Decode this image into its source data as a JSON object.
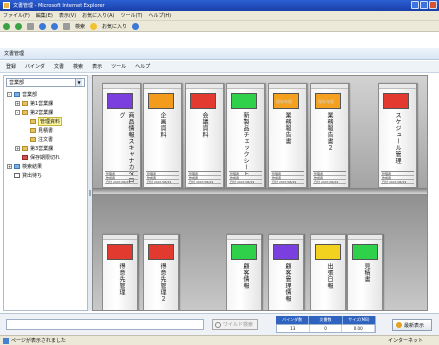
{
  "window": {
    "title": "文書管理 - Microsoft Internet Explorer"
  },
  "ie_menu": [
    "ファイル(F)",
    "編集(E)",
    "表示(V)",
    "お気に入り(A)",
    "ツール(T)",
    "ヘルプ(H)"
  ],
  "ie_toolbar": {
    "search_label": "検索",
    "favorites_label": "お気に入り"
  },
  "app": {
    "title": "文書管理",
    "menu": [
      "登録",
      "バインダ",
      "文書",
      "検索",
      "表示",
      "ツール",
      "ヘルプ"
    ]
  },
  "sidebar": {
    "dept_value": "営業部",
    "tree": [
      {
        "label": "営業部",
        "level": 0,
        "toggle": "-",
        "icon": "folder-blue"
      },
      {
        "label": "第1営業課",
        "level": 1,
        "toggle": "+",
        "icon": "folder"
      },
      {
        "label": "第2営業課",
        "level": 1,
        "toggle": "-",
        "icon": "folder"
      },
      {
        "label": "管理資料",
        "level": 2,
        "toggle": "",
        "icon": "folder",
        "selected": true
      },
      {
        "label": "見積書",
        "level": 2,
        "toggle": "",
        "icon": "folder"
      },
      {
        "label": "注文書",
        "level": 2,
        "toggle": "",
        "icon": "folder"
      },
      {
        "label": "第3営業課",
        "level": 1,
        "toggle": "+",
        "icon": "folder"
      },
      {
        "label": "保存期限切れ",
        "level": 1,
        "toggle": "",
        "icon": "folder-red"
      },
      {
        "label": "検索結果",
        "level": 0,
        "toggle": "+",
        "icon": "folder-blue"
      },
      {
        "label": "貸出待ち",
        "level": 0,
        "toggle": "",
        "icon": "doc"
      }
    ]
  },
  "binders_top": [
    {
      "title": "商品情報スキャナカタログ",
      "color": "#7b3fe0",
      "label_text": "",
      "foot": [
        "管理者",
        "作成者",
        "日付 2007/06/29"
      ]
    },
    {
      "title": "企画資料",
      "color": "#f39b1d",
      "label_text": "",
      "foot": [
        "管理者",
        "作成者",
        "日付 2007/06/29"
      ]
    },
    {
      "title": "会議資料",
      "color": "#e33a2f",
      "label_text": "",
      "foot": [
        "管理者",
        "作成者",
        "日付 2007/06/29"
      ]
    },
    {
      "title": "新製品チェックシート",
      "color": "#30d14a",
      "label_text": "",
      "foot": [
        "管理者",
        "作成者",
        "日付 2007/06/29"
      ]
    },
    {
      "title": "業務報告書",
      "color": "#f3a11f",
      "label_text": "保存年限",
      "foot": [
        "管理者",
        "作成者",
        "日付 2007/06/29"
      ]
    },
    {
      "title": "業務報告書２",
      "color": "#f3a11f",
      "label_text": "保存年限",
      "foot": [
        "管理者",
        "作成者",
        "日付 2007/06/29"
      ]
    },
    {
      "title": "スケジュール管理",
      "color": "#e33a2f",
      "label_text": "",
      "foot": [
        "管理者",
        "作成者",
        "日付 2007/06/29"
      ]
    }
  ],
  "binders_bottom": [
    {
      "title": "得意先管理",
      "color": "#e33a2f"
    },
    {
      "title": "得意先管理２",
      "color": "#e33a2f"
    },
    {
      "title": "顧客情報",
      "color": "#30d14a"
    },
    {
      "title": "顧客管理情報",
      "color": "#7b3fe0"
    },
    {
      "title": "出張日報",
      "color": "#f2d21f"
    },
    {
      "title": "見積書",
      "color": "#30d14a"
    }
  ],
  "footer": {
    "prefix_button": "ワイルド検索",
    "stats_headers": [
      "バインダ数",
      "文書数",
      "サイズ(MB)"
    ],
    "stats_values": [
      "13",
      "0",
      "0.00"
    ],
    "refresh_label": "最新表示"
  },
  "ie_status": {
    "text": "ページが表示されました",
    "zone": "インターネット"
  }
}
